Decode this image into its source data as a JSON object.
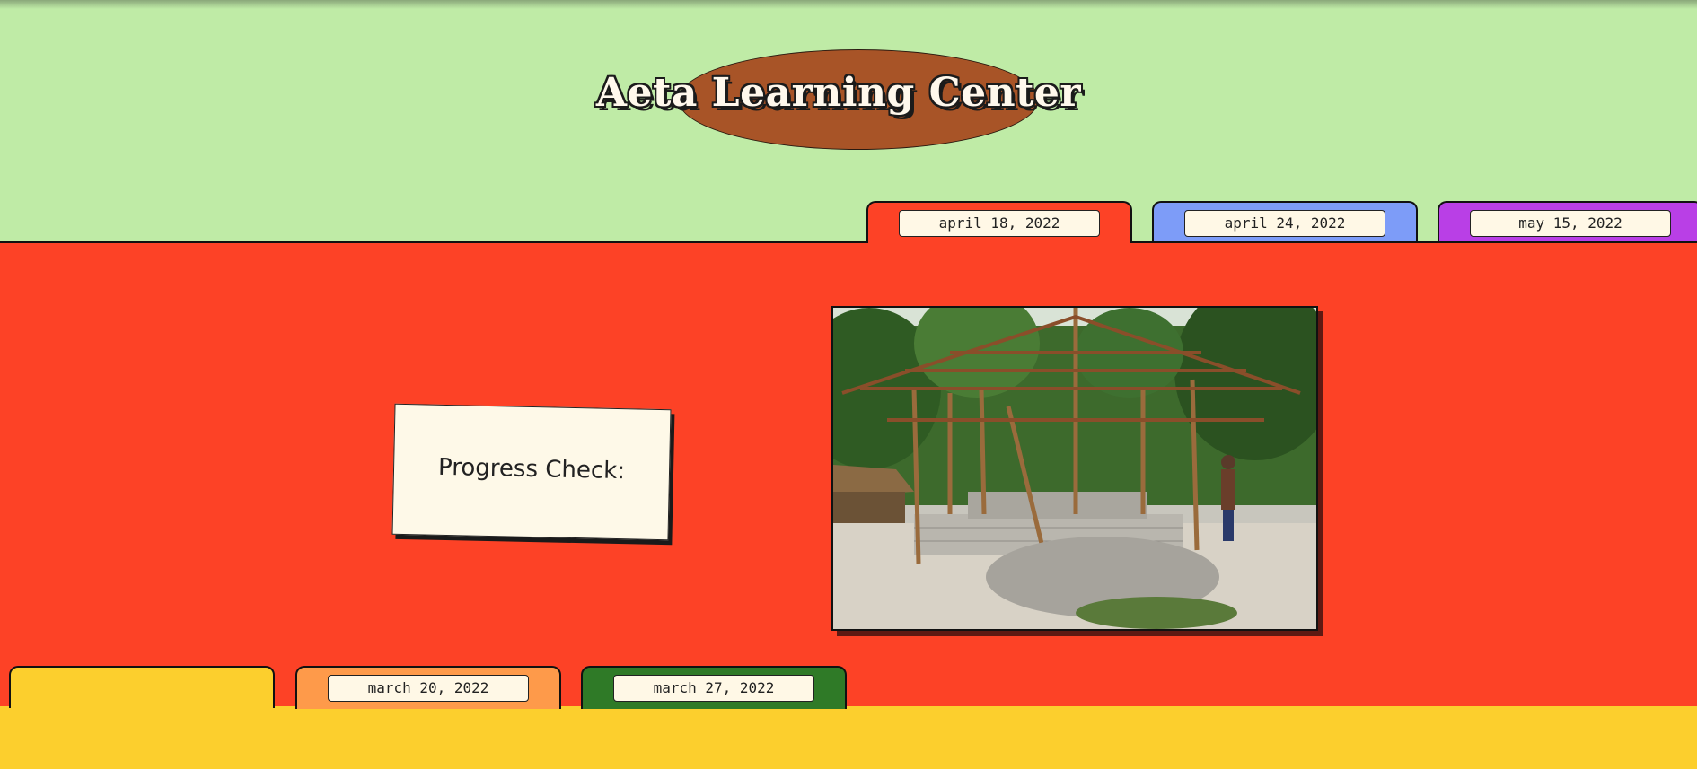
{
  "header": {
    "title": "Aeta Learning Center"
  },
  "top_tabs": [
    {
      "label": "april 18, 2022",
      "color": "#fd4226"
    },
    {
      "label": "april 24, 2022",
      "color": "#7d9cf8"
    },
    {
      "label": "may 15, 2022",
      "color": "#b93fe6"
    }
  ],
  "bottom_tabs": [
    {
      "label": "",
      "color": "#fccf2d"
    },
    {
      "label": "march 20, 2022",
      "color": "#fe9a4a"
    },
    {
      "label": "march 27, 2022",
      "color": "#2f7a27"
    }
  ],
  "main": {
    "progress_label": "Progress Check:",
    "photo_description": "construction-photo"
  },
  "colors": {
    "background": "#bfeba6",
    "active_panel": "#fd4226",
    "footer_panel": "#fccf2d",
    "title_oval": "#a85427"
  }
}
